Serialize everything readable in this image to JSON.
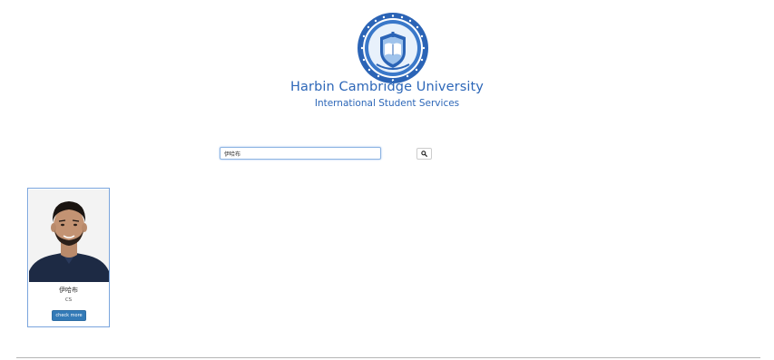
{
  "header": {
    "title": "Harbin Cambridge University",
    "subtitle": "International Student Services"
  },
  "search": {
    "value": "伊哈布",
    "icon": "search-icon"
  },
  "results": [
    {
      "name": "伊哈布",
      "major": "CS",
      "button_label": "check more"
    }
  ],
  "colors": {
    "brand_blue": "#2d67b8",
    "button_blue": "#337ab7",
    "card_border": "#7aa5dd"
  }
}
